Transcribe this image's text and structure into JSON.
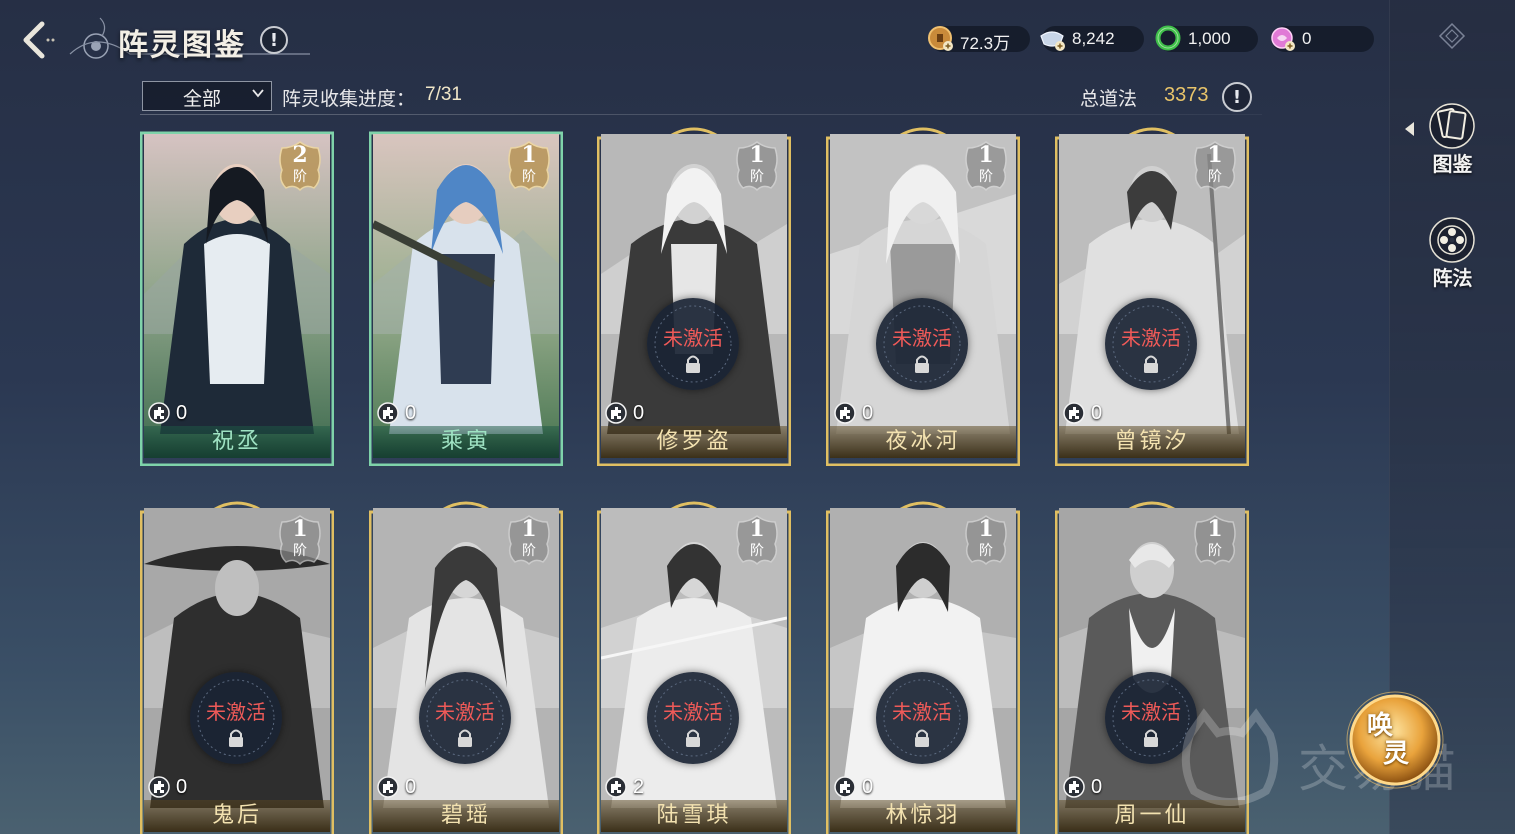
{
  "header": {
    "title": "阵灵图鉴",
    "info_symbol": "!"
  },
  "currencies": [
    {
      "name": "copper",
      "value": "72.3万",
      "icon": "copper-coin-icon",
      "color": "#c98a3a"
    },
    {
      "name": "silver",
      "value": "8,242",
      "icon": "silver-ingot-icon",
      "color": "#c9d6e8"
    },
    {
      "name": "jade",
      "value": "1,000",
      "icon": "jade-ring-icon",
      "color": "#3fbf4a"
    },
    {
      "name": "spirit",
      "value": "0",
      "icon": "pink-orb-icon",
      "color": "#e07ad6"
    }
  ],
  "toolbar": {
    "filter_selected": "全部",
    "progress_label": "阵灵收集进度：",
    "progress_value": "7/31",
    "total_label": "总道法",
    "total_value": "3373",
    "info_symbol": "!"
  },
  "sidebar": {
    "tabs": [
      {
        "label": "图鉴",
        "icon": "card-collection-icon",
        "selected": true
      },
      {
        "label": "阵法",
        "icon": "formation-flower-icon",
        "selected": false
      }
    ]
  },
  "cards": [
    {
      "name": "祝丞",
      "stage_num": "2",
      "stage_unit": "阶",
      "fragments": "0",
      "status": "active",
      "locked_text": ""
    },
    {
      "name": "乘寅",
      "stage_num": "1",
      "stage_unit": "阶",
      "fragments": "0",
      "status": "active",
      "locked_text": ""
    },
    {
      "name": "修罗盗",
      "stage_num": "1",
      "stage_unit": "阶",
      "fragments": "0",
      "status": "locked",
      "locked_text": "未激活"
    },
    {
      "name": "夜冰河",
      "stage_num": "1",
      "stage_unit": "阶",
      "fragments": "0",
      "status": "locked",
      "locked_text": "未激活"
    },
    {
      "name": "曾镜汐",
      "stage_num": "1",
      "stage_unit": "阶",
      "fragments": "0",
      "status": "locked",
      "locked_text": "未激活"
    },
    {
      "name": "鬼后",
      "stage_num": "1",
      "stage_unit": "阶",
      "fragments": "0",
      "status": "locked",
      "locked_text": "未激活"
    },
    {
      "name": "碧瑶",
      "stage_num": "1",
      "stage_unit": "阶",
      "fragments": "0",
      "status": "locked",
      "locked_text": "未激活"
    },
    {
      "name": "陆雪琪",
      "stage_num": "1",
      "stage_unit": "阶",
      "fragments": "2",
      "status": "locked",
      "locked_text": "未激活"
    },
    {
      "name": "林惊羽",
      "stage_num": "1",
      "stage_unit": "阶",
      "fragments": "0",
      "status": "locked",
      "locked_text": "未激活"
    },
    {
      "name": "周一仙",
      "stage_num": "1",
      "stage_unit": "阶",
      "fragments": "0",
      "status": "locked",
      "locked_text": "未激活"
    }
  ],
  "summon": {
    "label_top": "唤",
    "label_bottom": "灵"
  },
  "watermark": {
    "text": "交易猫"
  }
}
